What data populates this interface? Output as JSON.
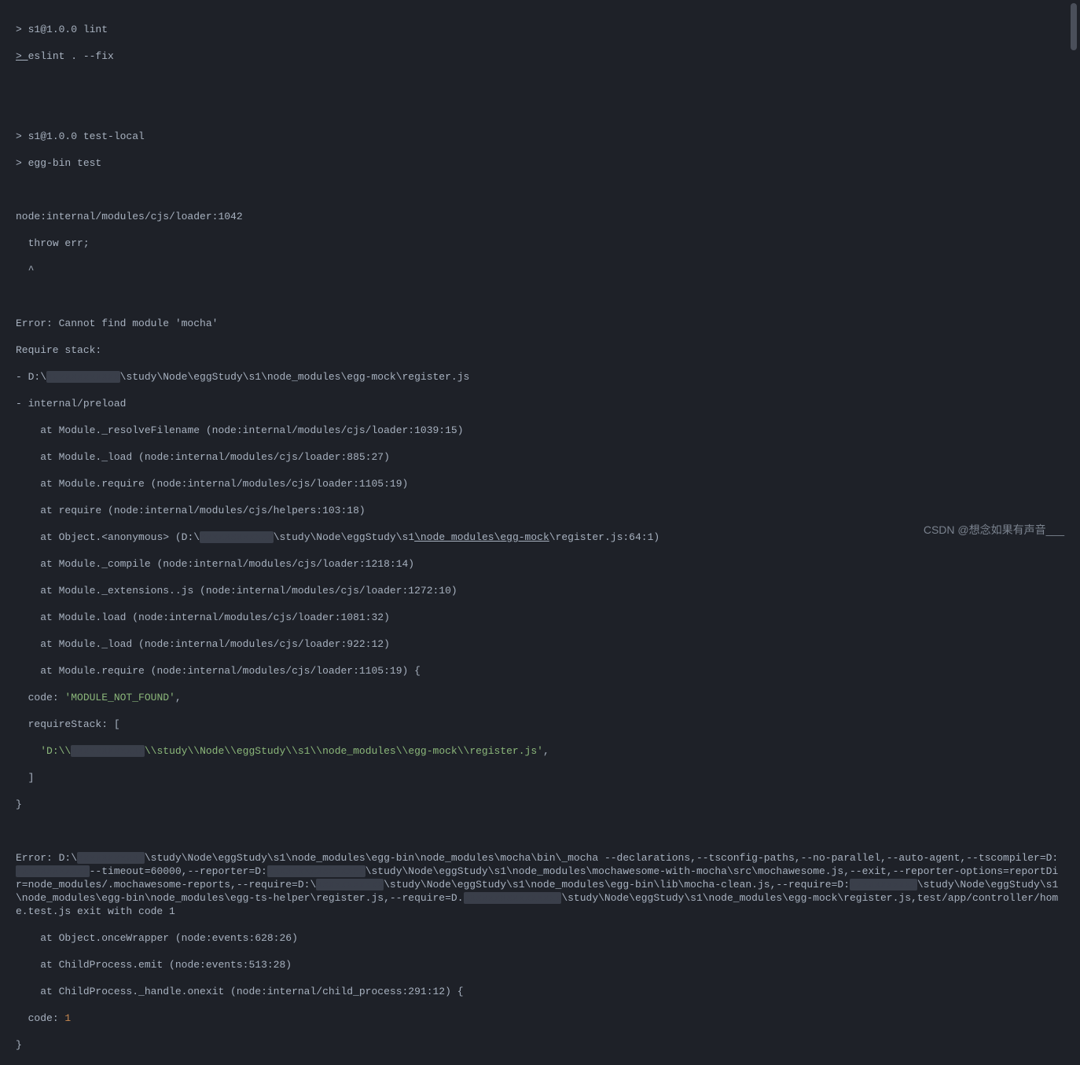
{
  "terminal": {
    "cmd1_prefix": "> ",
    "cmd1": "s1@1.0.0 lint",
    "cmd2_prefix": "> ",
    "cmd2": "eslint . --fix",
    "cmd3_prefix": "> ",
    "cmd3": "s1@1.0.0 test-local",
    "cmd4_prefix": "> ",
    "cmd4": "egg-bin test",
    "loader": "node:internal/modules/cjs/loader:1042",
    "throw": "  throw err;",
    "caret": "  ^",
    "err_main": "Error: Cannot find module 'mocha'",
    "req_stack": "Require stack:",
    "stack1_pre": "- D:\\",
    "stack1_mask": "xxxxxxxxxxxx",
    "stack1_post": "\\study\\Node\\eggStudy\\s1\\node_modules\\egg-mock\\register.js",
    "stack2": "- internal/preload",
    "at1": "    at Module._resolveFilename (node:internal/modules/cjs/loader:1039:15)",
    "at2": "    at Module._load (node:internal/modules/cjs/loader:885:27)",
    "at3": "    at Module.require (node:internal/modules/cjs/loader:1105:19)",
    "at4": "    at require (node:internal/modules/cjs/helpers:103:18)",
    "at5_pre": "    at Object.<anonymous> (D:\\",
    "at5_mask": "xxxxxxxxxxxx",
    "at5_mid": "\\study\\Node\\eggStudy\\s1",
    "at5_ul1": "\\node_modules\\",
    "at5_ul2": "egg-mock",
    "at5_post": "\\register.js:64:1)",
    "at6": "    at Module._compile (node:internal/modules/cjs/loader:1218:14)",
    "at7": "    at Module._extensions..js (node:internal/modules/cjs/loader:1272:10)",
    "at8": "    at Module.load (node:internal/modules/cjs/loader:1081:32)",
    "at9": "    at Module._load (node:internal/modules/cjs/loader:922:12)",
    "at10": "    at Module.require (node:internal/modules/cjs/loader:1105:19) {",
    "code_label": "  code: ",
    "code_val": "'MODULE_NOT_FOUND'",
    "code_comma": ",",
    "reqstack_open": "  requireStack: [",
    "reqstack_pre": "    'D:\\\\",
    "reqstack_mask": "xxxxxxxxxxxx",
    "reqstack_post": "\\\\study\\\\Node\\\\eggStudy\\\\s1\\\\node_modules\\\\egg-mock\\\\register.js'",
    "reqstack_comma": ",",
    "reqstack_close": "  ]",
    "brace1": "}",
    "err2_pre": "Error: D:\\",
    "err2_mask1": "xxxxxxxxxxx",
    "err2_p1": "\\study\\Node\\eggStudy\\s1\\node_modules\\egg-bin\\node_modules\\mocha\\bin\\_mocha --declarations,--tsconfig-paths,--no-parallel,--auto-agent,--tscompiler=D:",
    "err2_mask2": "xxxxxxxxxxxx",
    "err2_p2": "--timeout=60000,--reporter=D:",
    "err2_mask3": "xxxxxxxxxxxxxxxx",
    "err2_p3": "\\study\\Node\\eggStudy\\s1\\node_modules\\mochawesome-with-mocha\\src\\mochawesome.js,--exit,--reporter-options=reportDir=node_modules/.mochawesome-reports,--require=D:\\",
    "err2_mask4": "xxxxxxxxxxx",
    "err2_p4": "\\study\\Node\\eggStudy\\s1\\node_modules\\egg-bin\\lib\\mocha-clean.js,--require=D:",
    "err2_mask5": "xxxxxxxxxxx",
    "err2_p5": "\\study\\Node\\eggStudy\\s1\\node_modules\\egg-bin\\node_modules\\egg-ts-helper\\register.js,--require=D.",
    "err2_mask6": "xxxxxxxxxxxxxxxx",
    "err2_p6": "\\study\\Node\\eggStudy\\s1\\node_modules\\egg-mock\\register.js,test/app/controller/home.test.js exit with code 1",
    "at11": "    at Object.onceWrapper (node:events:628:26)",
    "at12": "    at ChildProcess.emit (node:events:513:28)",
    "at13": "    at ChildProcess._handle.onexit (node:internal/child_process:291:12) {",
    "code2_label": "  code: ",
    "code2_val": "1",
    "brace2": "}"
  },
  "watermark": "CSDN @想念如果有声音___"
}
